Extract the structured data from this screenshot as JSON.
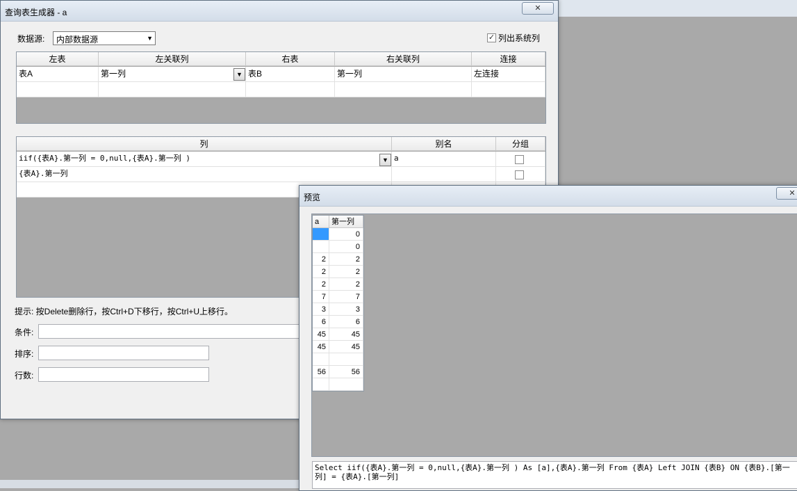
{
  "main_window": {
    "title": "查询表生成器 - a",
    "close": "✕",
    "datasource_label": "数据源:",
    "datasource_value": "内部数据源",
    "list_system_label": "列出系统列",
    "list_system_checked": "✓",
    "join_grid": {
      "headers": [
        "左表",
        "左关联列",
        "右表",
        "右关联列",
        "连接"
      ],
      "rows": [
        [
          "表A",
          "第一列",
          "表B",
          "第一列",
          "左连接"
        ]
      ]
    },
    "column_grid": {
      "headers": [
        "列",
        "别名",
        "分组"
      ],
      "rows": [
        [
          "iif({表A}.第一列 = 0,null,{表A}.第一列 )",
          "a"
        ],
        [
          "{表A}.第一列",
          ""
        ]
      ]
    },
    "hint": "提示: 按Delete删除行，按Ctrl+D下移行，按Ctrl+U上移行。",
    "condition_label": "条件:",
    "sort_label": "排序:",
    "rowcount_label": "行数:"
  },
  "preview_window": {
    "title": "预览",
    "close": "✕",
    "grid": {
      "headers": [
        "a",
        "第一列"
      ],
      "rows": [
        [
          "",
          "0"
        ],
        [
          "",
          "0"
        ],
        [
          "2",
          "2"
        ],
        [
          "2",
          "2"
        ],
        [
          "2",
          "2"
        ],
        [
          "7",
          "7"
        ],
        [
          "3",
          "3"
        ],
        [
          "6",
          "6"
        ],
        [
          "45",
          "45"
        ],
        [
          "45",
          "45"
        ],
        [
          "",
          ""
        ],
        [
          "56",
          "56"
        ],
        [
          "",
          ""
        ]
      ]
    },
    "sql": "Select  iif({表A}.第一列 = 0,null,{表A}.第一列 ) As [a],{表A}.第一列 From {表A} Left JOIN {表B} ON {表B}.[第一列] = {表A}.[第一列]"
  }
}
